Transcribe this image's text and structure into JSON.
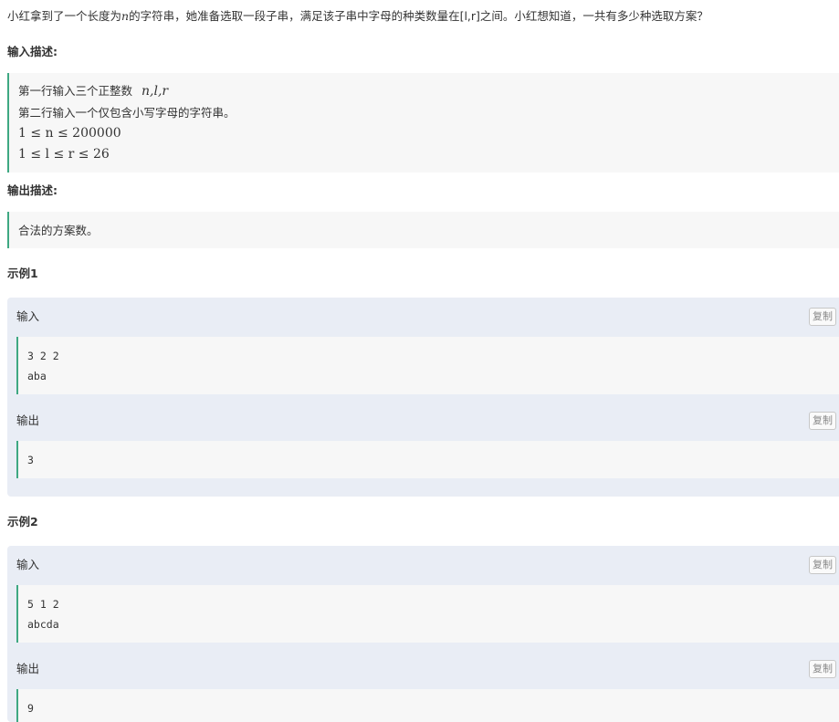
{
  "problem": {
    "desc_before": "小红拿到了一个长度为",
    "desc_var": "n",
    "desc_after": "的字符串，她准备选取一段子串，满足该子串中字母的种类数量在[l,r]之间。小红想知道，一共有多少种选取方案？"
  },
  "input_section": {
    "title": "输入描述:",
    "line1_text": "第一行输入三个正整数",
    "line1_math": "n,l,r",
    "line2": "第二行输入一个仅包含小写字母的字符串。",
    "constraint1": "1 ≤ n ≤ 200000",
    "constraint2": "1 ≤ l ≤ r ≤ 26"
  },
  "output_section": {
    "title": "输出描述:",
    "line1": "合法的方案数。"
  },
  "samples": [
    {
      "title": "示例1",
      "input_label": "输入",
      "input_lines": [
        "3 2 2",
        "aba"
      ],
      "output_label": "输出",
      "output_lines": [
        "3"
      ],
      "copy_label": "复制"
    },
    {
      "title": "示例2",
      "input_label": "输入",
      "input_lines": [
        "5 1 2",
        "abcda"
      ],
      "output_label": "输出",
      "output_lines": [
        "9"
      ],
      "copy_label": "复制"
    }
  ],
  "colors": {
    "accent_border": "#3ea882",
    "sample_bg": "#e9edf5",
    "code_bg": "#f7f7f7"
  }
}
